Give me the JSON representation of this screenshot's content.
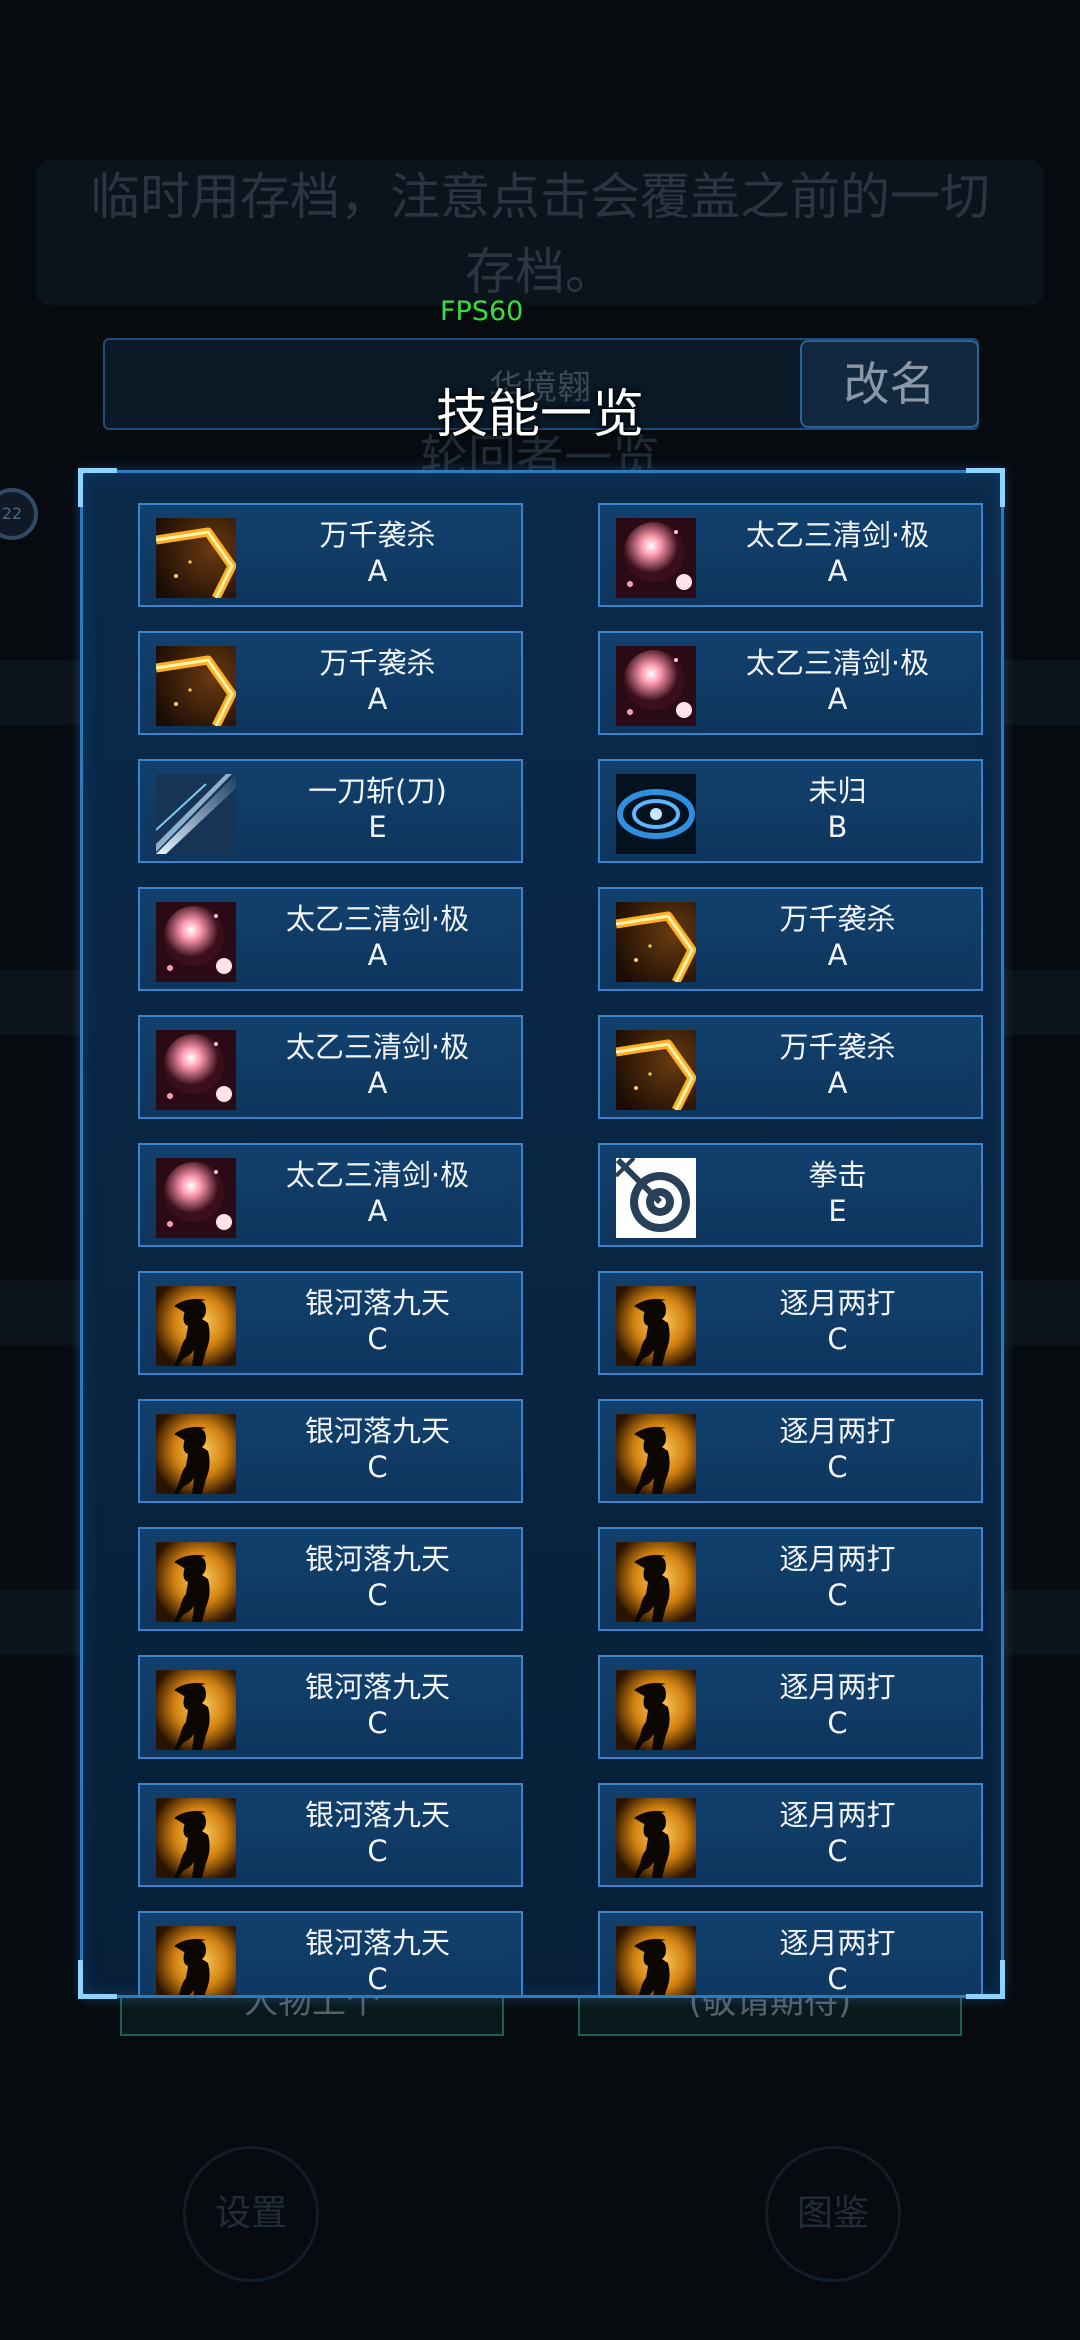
{
  "background": {
    "notice_lines": [
      "临时用存档，注意点击会覆盖之前的一切",
      "存档。"
    ],
    "player_name": "华境翱",
    "rename_label": "改名",
    "subtitle": "轮回者一览",
    "side_badge": "22",
    "bottom_left_button": "人物上个",
    "bottom_right_button": "(敬请期待)",
    "settings_label": "设置",
    "codex_label": "图鉴"
  },
  "fps": "FPS60",
  "modal": {
    "title": "技能一览",
    "skills": [
      {
        "name": "万千袭杀",
        "grade": "A",
        "icon": "golden-slash-icon"
      },
      {
        "name": "太乙三清剑·极",
        "grade": "A",
        "icon": "pink-orb-icon"
      },
      {
        "name": "万千袭杀",
        "grade": "A",
        "icon": "golden-slash-icon"
      },
      {
        "name": "太乙三清剑·极",
        "grade": "A",
        "icon": "pink-orb-icon"
      },
      {
        "name": "一刀斩(刀)",
        "grade": "E",
        "icon": "blade-light-icon"
      },
      {
        "name": "未归",
        "grade": "B",
        "icon": "blue-vortex-icon"
      },
      {
        "name": "太乙三清剑·极",
        "grade": "A",
        "icon": "pink-orb-icon"
      },
      {
        "name": "万千袭杀",
        "grade": "A",
        "icon": "golden-slash-icon"
      },
      {
        "name": "太乙三清剑·极",
        "grade": "A",
        "icon": "pink-orb-icon"
      },
      {
        "name": "万千袭杀",
        "grade": "A",
        "icon": "golden-slash-icon"
      },
      {
        "name": "太乙三清剑·极",
        "grade": "A",
        "icon": "pink-orb-icon"
      },
      {
        "name": "拳击",
        "grade": "E",
        "icon": "fist-target-icon"
      },
      {
        "name": "银河落九天",
        "grade": "C",
        "icon": "silhouette-warrior-icon"
      },
      {
        "name": "逐月两打",
        "grade": "C",
        "icon": "silhouette-warrior-icon"
      },
      {
        "name": "银河落九天",
        "grade": "C",
        "icon": "silhouette-warrior-icon"
      },
      {
        "name": "逐月两打",
        "grade": "C",
        "icon": "silhouette-warrior-icon"
      },
      {
        "name": "银河落九天",
        "grade": "C",
        "icon": "silhouette-warrior-icon"
      },
      {
        "name": "逐月两打",
        "grade": "C",
        "icon": "silhouette-warrior-icon"
      },
      {
        "name": "银河落九天",
        "grade": "C",
        "icon": "silhouette-warrior-icon"
      },
      {
        "name": "逐月两打",
        "grade": "C",
        "icon": "silhouette-warrior-icon"
      },
      {
        "name": "银河落九天",
        "grade": "C",
        "icon": "silhouette-warrior-icon"
      },
      {
        "name": "逐月两打",
        "grade": "C",
        "icon": "silhouette-warrior-icon"
      },
      {
        "name": "银河落九天",
        "grade": "C",
        "icon": "silhouette-warrior-icon"
      },
      {
        "name": "逐月两打",
        "grade": "C",
        "icon": "silhouette-warrior-icon"
      }
    ]
  }
}
